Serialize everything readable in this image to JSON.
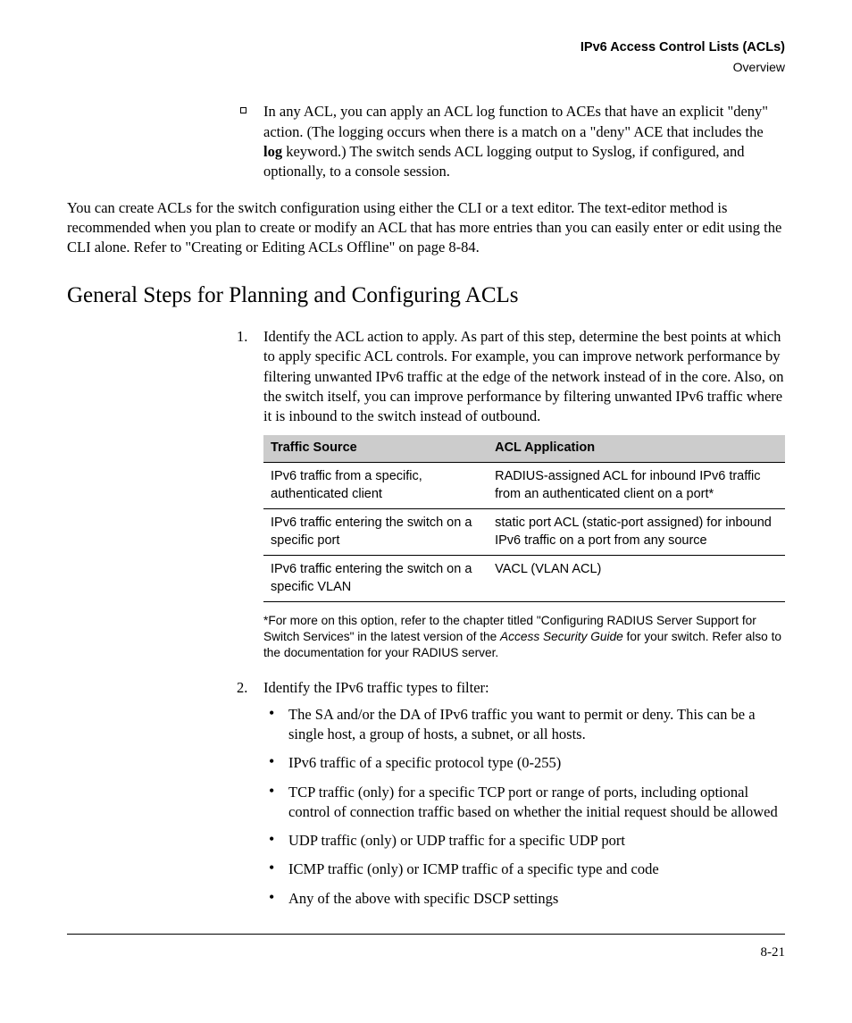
{
  "header": {
    "title": "IPv6 Access Control Lists (ACLs)",
    "subtitle": "Overview"
  },
  "squareBullet": {
    "pre": "In any ACL, you can apply an ACL log function to ACEs that have an explicit \"deny\" action. (The logging occurs when there is a match on a \"deny\" ACE that includes the ",
    "bold": "log",
    "post": " keyword.) The switch sends ACL logging output to Syslog, if configured, and optionally, to a console session."
  },
  "para1": "You can create ACLs for the switch configuration using either the CLI or a text editor. The text-editor method is recommended when you plan to create or modify an ACL that has more entries than you can easily enter or edit using the CLI alone. Refer to \"Creating or Editing ACLs Offline\" on page 8-84.",
  "sectionTitle": "General Steps for Planning and Configuring ACLs",
  "step1": "Identify the ACL action to apply.  As part of this step, determine the best points at which to apply specific ACL controls. For example, you can improve network performance by filtering unwanted IPv6 traffic at the edge of the network instead of in the core. Also, on the switch itself, you can improve performance by filtering unwanted IPv6 traffic where it is inbound to the switch instead of outbound.",
  "table": {
    "hdr1": "Traffic Source",
    "hdr2": "ACL Application",
    "rows": [
      {
        "src": "IPv6 traffic from a specific, authenticated client",
        "app": "RADIUS-assigned ACL for inbound IPv6 traffic from an authenticated client on a port*"
      },
      {
        "src": "IPv6 traffic entering the switch on a specific port",
        "app": "static port ACL (static-port assigned) for inbound IPv6 traffic on a port from any source"
      },
      {
        "src": "IPv6 traffic entering the switch on a specific VLAN",
        "app": "VACL (VLAN ACL)"
      }
    ]
  },
  "footnote": {
    "pre": "*For more on this option, refer to the chapter titled \"Configuring RADIUS Server Support for Switch Services\" in the latest version of the ",
    "ital": "Access Security Guide",
    "post": " for your switch. Refer also to the documentation for your RADIUS server."
  },
  "step2": "Identify the IPv6 traffic types to filter:",
  "step2bullets": [
    "The SA and/or the DA of IPv6 traffic you want to permit or deny. This can be a single host, a group of hosts, a subnet, or all hosts.",
    "IPv6 traffic of a specific protocol type (0-255)",
    "TCP traffic (only) for a specific TCP port or range of ports, including optional control of connection traffic based on whether the initial request should be allowed",
    "UDP traffic (only) or UDP traffic for a specific UDP port",
    "ICMP traffic (only) or ICMP traffic of a specific type and code",
    "Any of the above with specific DSCP settings"
  ],
  "pageNum": "8-21"
}
